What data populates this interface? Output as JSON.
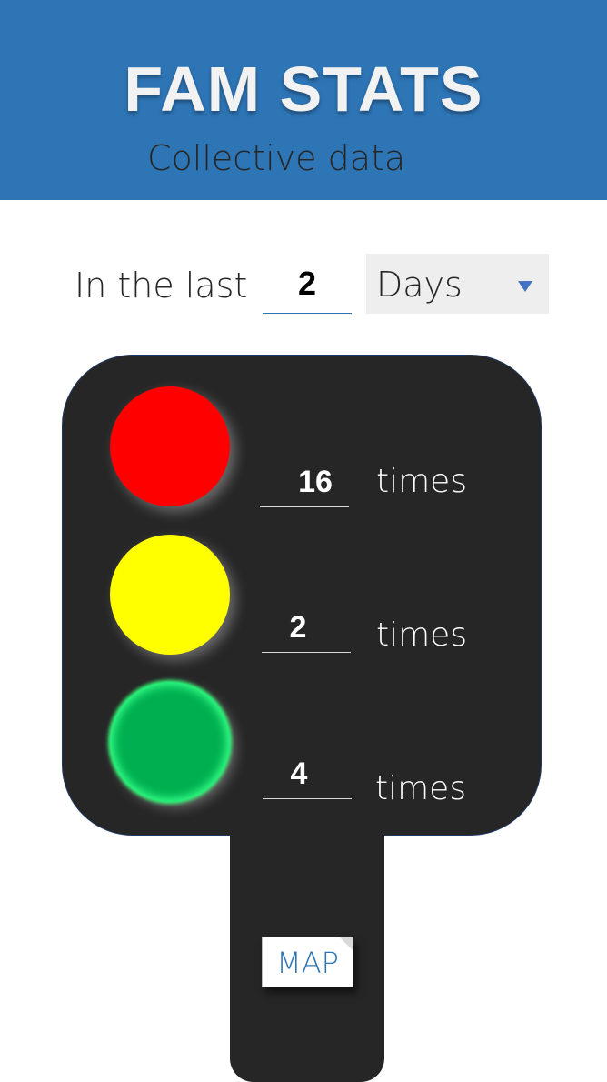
{
  "header": {
    "title": "FAM STATS",
    "subtitle": "Collective data"
  },
  "filter": {
    "label": "In the last",
    "period_value": "2",
    "unit_selected": "Days"
  },
  "traffic_light": {
    "red": {
      "color": "#ff0000",
      "count": "16",
      "suffix": "times"
    },
    "yellow": {
      "color": "#ffff00",
      "count": "2",
      "suffix": "times"
    },
    "green": {
      "color": "#00b050",
      "count": "4",
      "suffix": "times"
    }
  },
  "actions": {
    "map_label": "MAP"
  },
  "colors": {
    "header_bg": "#2e75b6",
    "signal_body": "#262626",
    "accent": "#4472c4"
  }
}
